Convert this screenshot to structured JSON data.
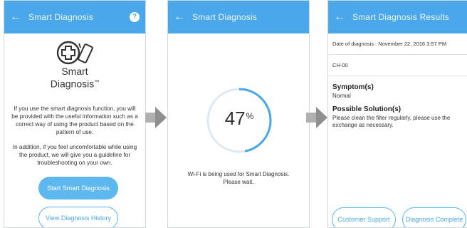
{
  "screen1": {
    "title": "Smart Diagnosis",
    "help_icon": "?",
    "logo_line1": "Smart",
    "logo_line2": "Diagnosis",
    "trademark": "™",
    "para1": "If you use the smart diagnosis function, you will be provided with the useful information such as a correct way of using the product based on the pattern of use.",
    "para2": "In addition, if you feel uncomfortable while using the product, we will give you a guideline for troubleshooting on your own.",
    "start_button": "Start Smart Diagnosis",
    "history_button": "View Diagnosis History"
  },
  "screen2": {
    "title": "Smart Diagnosis",
    "progress_value": "47",
    "progress_unit": "%",
    "progress_fraction": 0.47,
    "status_line1": "Wi-Fi is being used for Smart Diagnosis.",
    "status_line2": "Please wait."
  },
  "screen3": {
    "title": "Smart Diagnosis Results",
    "date_line": "Date of diagnosis : November 22, 2016 3:57 PM",
    "code": "CH-00",
    "symptom_heading": "Symptom(s)",
    "symptom_text": "Normal",
    "solution_heading": "Possible Solution(s)",
    "solution_text": "Please clean the filter regularly, please use the exchange as necessary.",
    "support_button": "Customer Support",
    "complete_button": "Diagnosis Complete"
  },
  "icons": {
    "back": "←",
    "arrow": "flow-arrow-icon"
  },
  "colors": {
    "accent": "#4aa8ea",
    "button_fill": "#5cb8ef",
    "arrow_gray": "#9e9e9e"
  }
}
